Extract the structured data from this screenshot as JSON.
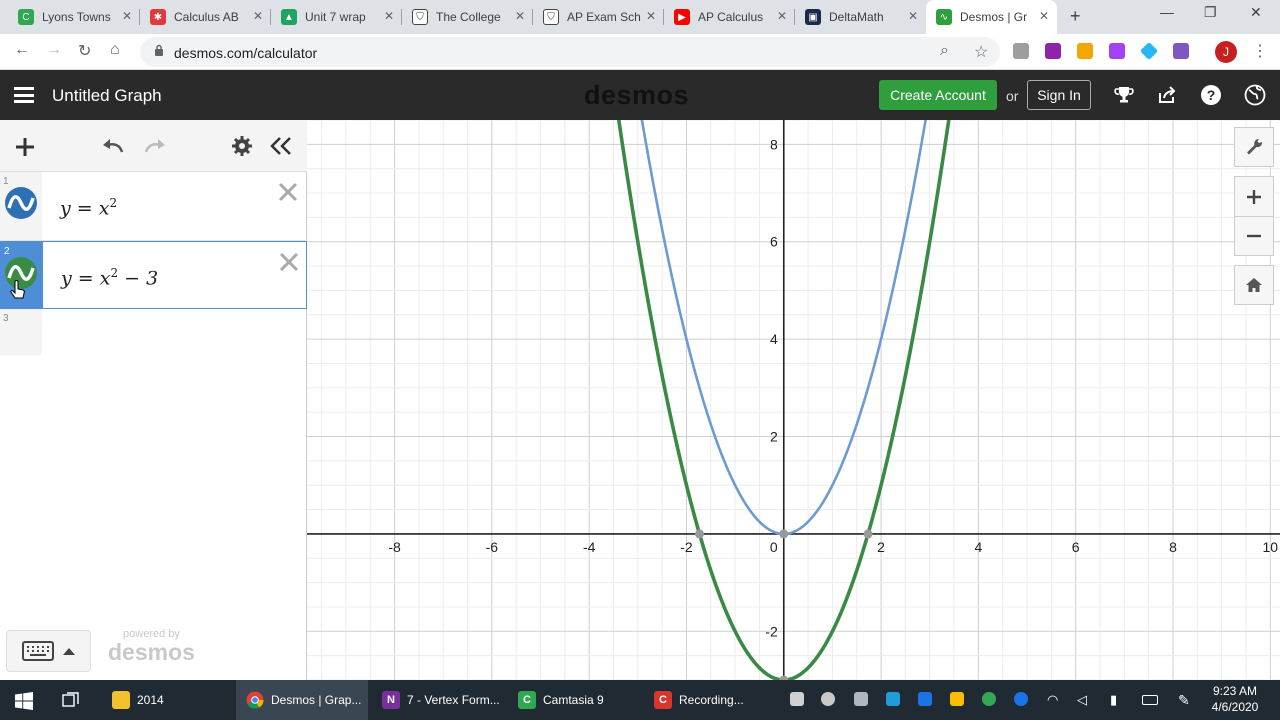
{
  "browser": {
    "tabs": [
      {
        "title": "Lyons Towns",
        "favicon_color": "#2fa84f"
      },
      {
        "title": "Calculus AB",
        "favicon_color": "#e0393e"
      },
      {
        "title": "Unit 7 wrap",
        "favicon_color": "#1fa463"
      },
      {
        "title": "The College",
        "favicon_color": "#444444"
      },
      {
        "title": "AP Exam Sch",
        "favicon_color": "#444444"
      },
      {
        "title": "AP Calculus",
        "favicon_color": "#ff0000"
      },
      {
        "title": "DeltaMath",
        "favicon_color": "#1a2a4a"
      },
      {
        "title": "Desmos | Gr",
        "favicon_color": "#2f9f3d"
      }
    ],
    "url": "desmos.com/calculator",
    "avatar_letter": "J"
  },
  "desmos": {
    "graph_title": "Untitled Graph",
    "logo": "desmos",
    "create_account": "Create Account",
    "or": "or",
    "sign_in": "Sign In",
    "powered_by": "powered by",
    "powered_logo": "desmos",
    "expressions": [
      {
        "num": "1",
        "lhs": "y = x",
        "sup": "2",
        "tail": "",
        "color": "#2d70b3"
      },
      {
        "num": "2",
        "lhs": "y = x",
        "sup": "2",
        "tail": " − 3",
        "color": "#388c46"
      }
    ],
    "empty_row_num": "3",
    "graph": {
      "x_ticks": [
        "-8",
        "-6",
        "-4",
        "-2",
        "0",
        "2",
        "4",
        "6",
        "8",
        "10"
      ],
      "y_ticks": [
        "8",
        "6",
        "4",
        "2",
        "-2"
      ]
    }
  },
  "chart_data": {
    "type": "line",
    "xlim": [
      -9.8,
      10.2
    ],
    "ylim": [
      -3,
      8.5
    ],
    "grid": true,
    "x_ticks": [
      -8,
      -6,
      -4,
      -2,
      0,
      2,
      4,
      6,
      8,
      10
    ],
    "y_ticks": [
      -2,
      2,
      4,
      6,
      8
    ],
    "series": [
      {
        "expr": "y=x^2",
        "color": "#6b9bd1",
        "shift": 0
      },
      {
        "expr": "y=x^2-3",
        "color": "#3a8a45",
        "shift": -3
      }
    ],
    "highlight_points": [
      [
        -1.732,
        0
      ],
      [
        1.732,
        0
      ],
      [
        0,
        0
      ],
      [
        0,
        -3
      ]
    ]
  },
  "taskbar": {
    "items": [
      {
        "label": "2014",
        "color": "#f2c12e"
      },
      {
        "label": "Desmos | Grap...",
        "color": "#ea4335"
      },
      {
        "label": "7 - Vertex Form...",
        "color": "#7a2f9d"
      },
      {
        "label": "Camtasia 9",
        "color": "#2fa84f"
      },
      {
        "label": "Recording...",
        "color": "#d9362b"
      }
    ],
    "time": "9:23 AM",
    "date": "4/6/2020"
  }
}
